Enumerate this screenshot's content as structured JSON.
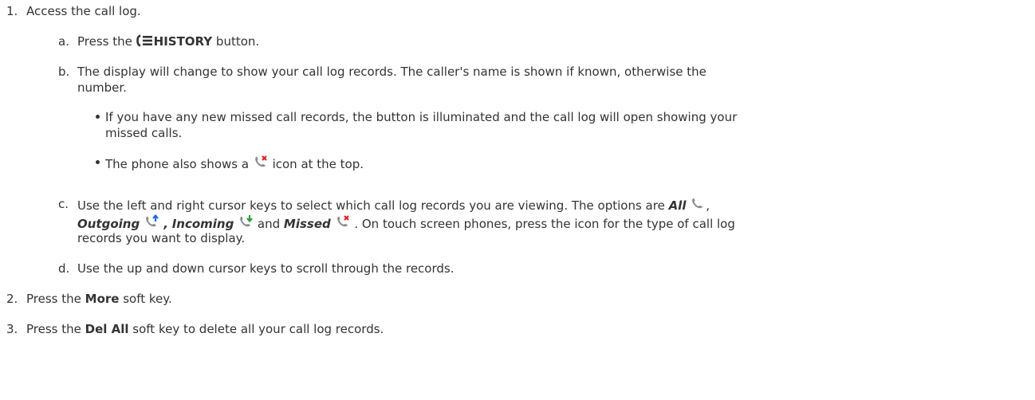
{
  "steps": [
    {
      "num": "1.",
      "text": "Access the call log."
    },
    {
      "num": "2.",
      "text_before": "Press the ",
      "bold": "More",
      "text_after": " soft key."
    },
    {
      "num": "3.",
      "text_before": "Press the ",
      "bold": "Del All",
      "text_after": " soft key to delete all your call log records."
    }
  ],
  "substeps": {
    "a": {
      "letter": "a.",
      "text_before": "Press the ",
      "bold": "HISTORY",
      "text_after": " button."
    },
    "b": {
      "letter": "b.",
      "line1": "The display will change to show your call log records. The caller's name is shown if known, otherwise the",
      "line2": "number."
    },
    "c": {
      "letter": "c.",
      "line1": "Use the left and right cursor keys to select which call log records you are viewing. The options are ",
      "all": "All",
      "comma1": ",",
      "outgoing": "Outgoing",
      "comma2": " ,",
      "incoming": "Incoming",
      "and": "and",
      "missed": "Missed",
      "line2_rest": ". On touch screen phones, press the icon for the type of call log",
      "line3": "records you want to display."
    },
    "d": {
      "letter": "d.",
      "text": "Use the up and down cursor keys to scroll through the records."
    }
  },
  "bullets": [
    {
      "line1": "If you have any new missed call records, the button is illuminated and the call log will open showing your",
      "line2": "missed calls."
    },
    {
      "text_before": "The phone also shows a ",
      "text_after": " icon at the top."
    }
  ],
  "icons": {
    "history": "history-icon",
    "all": "phone-icon",
    "outgoing": "outgoing-call-icon",
    "incoming": "incoming-call-icon",
    "missed": "missed-call-icon"
  },
  "colors": {
    "text": "#333333",
    "icon_gray": "#8a8a8a",
    "outgoing_arrow": "#1e6fd9",
    "incoming_arrow": "#2e9e3a",
    "missed_x": "#e02020"
  }
}
